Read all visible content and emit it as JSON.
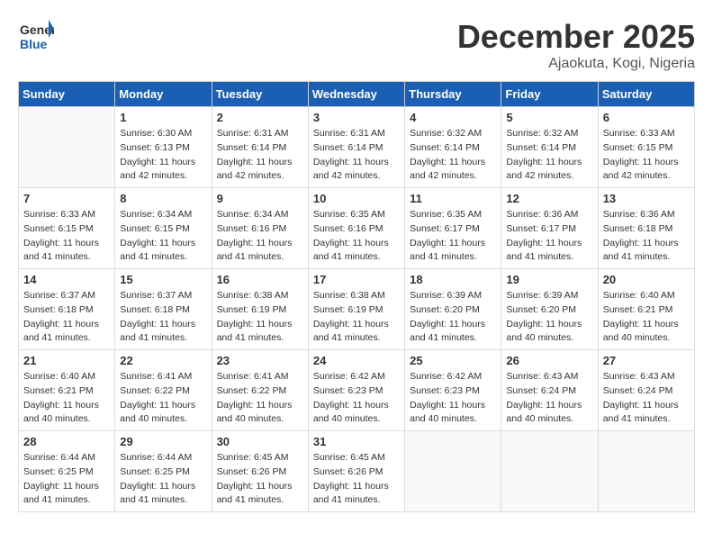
{
  "header": {
    "logo_general": "General",
    "logo_blue": "Blue",
    "month_year": "December 2025",
    "location": "Ajaokuta, Kogi, Nigeria"
  },
  "weekdays": [
    "Sunday",
    "Monday",
    "Tuesday",
    "Wednesday",
    "Thursday",
    "Friday",
    "Saturday"
  ],
  "weeks": [
    [
      {
        "day": "",
        "sunrise": "",
        "sunset": "",
        "daylight": ""
      },
      {
        "day": "1",
        "sunrise": "Sunrise: 6:30 AM",
        "sunset": "Sunset: 6:13 PM",
        "daylight": "Daylight: 11 hours and 42 minutes."
      },
      {
        "day": "2",
        "sunrise": "Sunrise: 6:31 AM",
        "sunset": "Sunset: 6:14 PM",
        "daylight": "Daylight: 11 hours and 42 minutes."
      },
      {
        "day": "3",
        "sunrise": "Sunrise: 6:31 AM",
        "sunset": "Sunset: 6:14 PM",
        "daylight": "Daylight: 11 hours and 42 minutes."
      },
      {
        "day": "4",
        "sunrise": "Sunrise: 6:32 AM",
        "sunset": "Sunset: 6:14 PM",
        "daylight": "Daylight: 11 hours and 42 minutes."
      },
      {
        "day": "5",
        "sunrise": "Sunrise: 6:32 AM",
        "sunset": "Sunset: 6:14 PM",
        "daylight": "Daylight: 11 hours and 42 minutes."
      },
      {
        "day": "6",
        "sunrise": "Sunrise: 6:33 AM",
        "sunset": "Sunset: 6:15 PM",
        "daylight": "Daylight: 11 hours and 42 minutes."
      }
    ],
    [
      {
        "day": "7",
        "sunrise": "Sunrise: 6:33 AM",
        "sunset": "Sunset: 6:15 PM",
        "daylight": "Daylight: 11 hours and 41 minutes."
      },
      {
        "day": "8",
        "sunrise": "Sunrise: 6:34 AM",
        "sunset": "Sunset: 6:15 PM",
        "daylight": "Daylight: 11 hours and 41 minutes."
      },
      {
        "day": "9",
        "sunrise": "Sunrise: 6:34 AM",
        "sunset": "Sunset: 6:16 PM",
        "daylight": "Daylight: 11 hours and 41 minutes."
      },
      {
        "day": "10",
        "sunrise": "Sunrise: 6:35 AM",
        "sunset": "Sunset: 6:16 PM",
        "daylight": "Daylight: 11 hours and 41 minutes."
      },
      {
        "day": "11",
        "sunrise": "Sunrise: 6:35 AM",
        "sunset": "Sunset: 6:17 PM",
        "daylight": "Daylight: 11 hours and 41 minutes."
      },
      {
        "day": "12",
        "sunrise": "Sunrise: 6:36 AM",
        "sunset": "Sunset: 6:17 PM",
        "daylight": "Daylight: 11 hours and 41 minutes."
      },
      {
        "day": "13",
        "sunrise": "Sunrise: 6:36 AM",
        "sunset": "Sunset: 6:18 PM",
        "daylight": "Daylight: 11 hours and 41 minutes."
      }
    ],
    [
      {
        "day": "14",
        "sunrise": "Sunrise: 6:37 AM",
        "sunset": "Sunset: 6:18 PM",
        "daylight": "Daylight: 11 hours and 41 minutes."
      },
      {
        "day": "15",
        "sunrise": "Sunrise: 6:37 AM",
        "sunset": "Sunset: 6:18 PM",
        "daylight": "Daylight: 11 hours and 41 minutes."
      },
      {
        "day": "16",
        "sunrise": "Sunrise: 6:38 AM",
        "sunset": "Sunset: 6:19 PM",
        "daylight": "Daylight: 11 hours and 41 minutes."
      },
      {
        "day": "17",
        "sunrise": "Sunrise: 6:38 AM",
        "sunset": "Sunset: 6:19 PM",
        "daylight": "Daylight: 11 hours and 41 minutes."
      },
      {
        "day": "18",
        "sunrise": "Sunrise: 6:39 AM",
        "sunset": "Sunset: 6:20 PM",
        "daylight": "Daylight: 11 hours and 41 minutes."
      },
      {
        "day": "19",
        "sunrise": "Sunrise: 6:39 AM",
        "sunset": "Sunset: 6:20 PM",
        "daylight": "Daylight: 11 hours and 40 minutes."
      },
      {
        "day": "20",
        "sunrise": "Sunrise: 6:40 AM",
        "sunset": "Sunset: 6:21 PM",
        "daylight": "Daylight: 11 hours and 40 minutes."
      }
    ],
    [
      {
        "day": "21",
        "sunrise": "Sunrise: 6:40 AM",
        "sunset": "Sunset: 6:21 PM",
        "daylight": "Daylight: 11 hours and 40 minutes."
      },
      {
        "day": "22",
        "sunrise": "Sunrise: 6:41 AM",
        "sunset": "Sunset: 6:22 PM",
        "daylight": "Daylight: 11 hours and 40 minutes."
      },
      {
        "day": "23",
        "sunrise": "Sunrise: 6:41 AM",
        "sunset": "Sunset: 6:22 PM",
        "daylight": "Daylight: 11 hours and 40 minutes."
      },
      {
        "day": "24",
        "sunrise": "Sunrise: 6:42 AM",
        "sunset": "Sunset: 6:23 PM",
        "daylight": "Daylight: 11 hours and 40 minutes."
      },
      {
        "day": "25",
        "sunrise": "Sunrise: 6:42 AM",
        "sunset": "Sunset: 6:23 PM",
        "daylight": "Daylight: 11 hours and 40 minutes."
      },
      {
        "day": "26",
        "sunrise": "Sunrise: 6:43 AM",
        "sunset": "Sunset: 6:24 PM",
        "daylight": "Daylight: 11 hours and 40 minutes."
      },
      {
        "day": "27",
        "sunrise": "Sunrise: 6:43 AM",
        "sunset": "Sunset: 6:24 PM",
        "daylight": "Daylight: 11 hours and 41 minutes."
      }
    ],
    [
      {
        "day": "28",
        "sunrise": "Sunrise: 6:44 AM",
        "sunset": "Sunset: 6:25 PM",
        "daylight": "Daylight: 11 hours and 41 minutes."
      },
      {
        "day": "29",
        "sunrise": "Sunrise: 6:44 AM",
        "sunset": "Sunset: 6:25 PM",
        "daylight": "Daylight: 11 hours and 41 minutes."
      },
      {
        "day": "30",
        "sunrise": "Sunrise: 6:45 AM",
        "sunset": "Sunset: 6:26 PM",
        "daylight": "Daylight: 11 hours and 41 minutes."
      },
      {
        "day": "31",
        "sunrise": "Sunrise: 6:45 AM",
        "sunset": "Sunset: 6:26 PM",
        "daylight": "Daylight: 11 hours and 41 minutes."
      },
      {
        "day": "",
        "sunrise": "",
        "sunset": "",
        "daylight": ""
      },
      {
        "day": "",
        "sunrise": "",
        "sunset": "",
        "daylight": ""
      },
      {
        "day": "",
        "sunrise": "",
        "sunset": "",
        "daylight": ""
      }
    ]
  ]
}
